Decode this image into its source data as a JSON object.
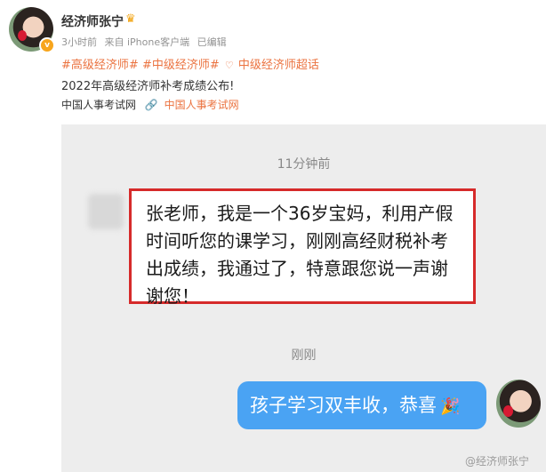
{
  "post": {
    "username": "经济师张宁",
    "crown_icon": "crown-icon",
    "meta": {
      "time": "3小时前",
      "source": "来自 iPhone客户端",
      "edited": "已编辑"
    },
    "topics": [
      "#高级经济师#",
      "#中级经济师#",
      "中级经济师超话"
    ],
    "text": "2022年高级经济师补考成绩公布!",
    "link": {
      "label": "中国人事考试网",
      "text": "中国人事考试网"
    }
  },
  "chat": {
    "time1": "11分钟前",
    "incoming": "张老师，我是一个36岁宝妈，利用产假时间听您的课学习，刚刚高经财税补考出成绩，我通过了，特意跟您说一声谢谢您！",
    "time2": "刚刚",
    "outgoing": "孩子学习双丰收，恭喜",
    "emoji": "🎉"
  },
  "watermark": "@经济师张宁",
  "colors": {
    "accent": "#eb7340",
    "bubble": "#4aa3f3",
    "highlight_border": "#d62a2a"
  }
}
